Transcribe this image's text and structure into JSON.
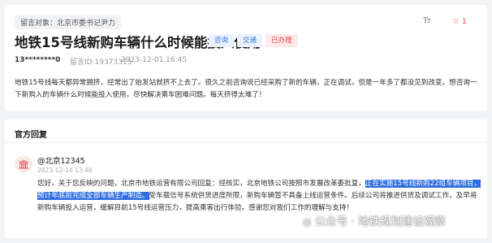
{
  "question": {
    "target_tag": "留言对象：北京市委书记尹力",
    "font_toggle_label": "Tт",
    "like_count": "1",
    "title": "地铁15号线新购车辆什么时候能投入使用",
    "tags": [
      "咨询",
      "交通",
      "已办理"
    ],
    "user": "13********0",
    "message_id": "留言ID:19373315",
    "time": "2023-12-01 16:45",
    "content": "地铁15号线每天都异常拥挤，经常出了始发站就挤不上去了。很久之前咨询说已经采购了新的车辆，正在调试，但是一年多了都没见到改变。想咨询一下新购入的车辆什么时候能投入使用，尽快解决乘车困难问题。每天挤得太难了！"
  },
  "reply": {
    "section_title": "官方回复",
    "replier": "@北京12345",
    "reply_time": "2023-12-14 13:46",
    "body_part1": "您好，关于您反映的问题，北京市地铁运营有限公司回复：经核实，北京地铁公司按照市发展改革委批复，",
    "body_highlight": "正在实施15号线新购22组车辆项目，预计年底前完成全部车辆生产制造。",
    "body_part2": "受车载信号系统供货进度所限，新购车辆暂不具备上线运营条件。后续公司将推进供货及调试工作，及早将新购车辆投入运营，缓解目前15号线运营压力，提高乘客出行体验。感谢您对我们工作的理解与支持！"
  },
  "watermark": "公众号 · 地铁规划建设观察",
  "colors": {
    "accent_blue": "#3a7be0",
    "accent_red": "#e0464a",
    "highlight": "#2d6ce0"
  }
}
